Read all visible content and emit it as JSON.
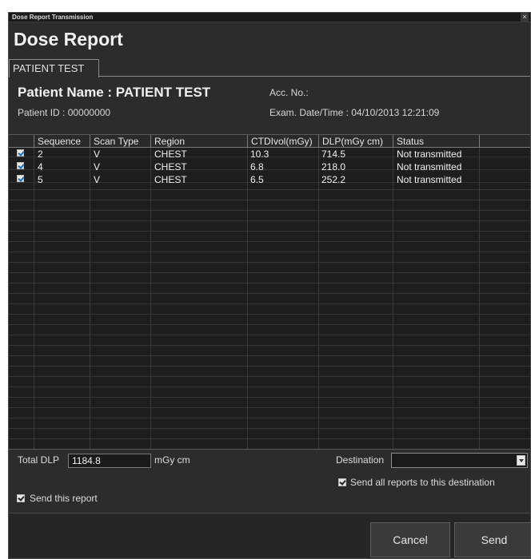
{
  "window": {
    "title": "Dose Report Transmission",
    "close_glyph": "×",
    "heading": "Dose Report"
  },
  "tab": {
    "label": "PATIENT TEST"
  },
  "patient": {
    "name": "Patient Name : PATIENT  TEST",
    "id": "Patient ID : 00000000",
    "acc": "Acc. No.:",
    "exam": "Exam. Date/Time : 04/10/2013  12:21:09"
  },
  "table": {
    "columns": [
      "Sequence",
      "Scan Type",
      "Region",
      "CTDIvol(mGy)",
      "DLP(mGy cm)",
      "Status"
    ],
    "rows": [
      {
        "checked": true,
        "sequence": "2",
        "scan_type": "V",
        "region": "CHEST",
        "ctdivol": "10.3",
        "dlp": "714.5",
        "status": "Not transmitted"
      },
      {
        "checked": true,
        "sequence": "4",
        "scan_type": "V",
        "region": "CHEST",
        "ctdivol": "6.8",
        "dlp": "218.0",
        "status": "Not transmitted"
      },
      {
        "checked": true,
        "sequence": "5",
        "scan_type": "V",
        "region": "CHEST",
        "ctdivol": "6.5",
        "dlp": "252.2",
        "status": "Not transmitted"
      }
    ]
  },
  "summary": {
    "total_label": "Total DLP",
    "total_value": "1184.8",
    "unit": "mGy cm",
    "destination_label": "Destination",
    "destination_value": "",
    "send_all_label": "Send all reports to this destination",
    "send_all_checked": true,
    "send_this_label": "Send this report",
    "send_this_checked": true
  },
  "buttons": {
    "cancel": "Cancel",
    "send": "Send"
  },
  "colors": {
    "background": "#2c2c2c",
    "grid": "#1e1e1e",
    "checkbox_tick": "#1d6fbf"
  }
}
